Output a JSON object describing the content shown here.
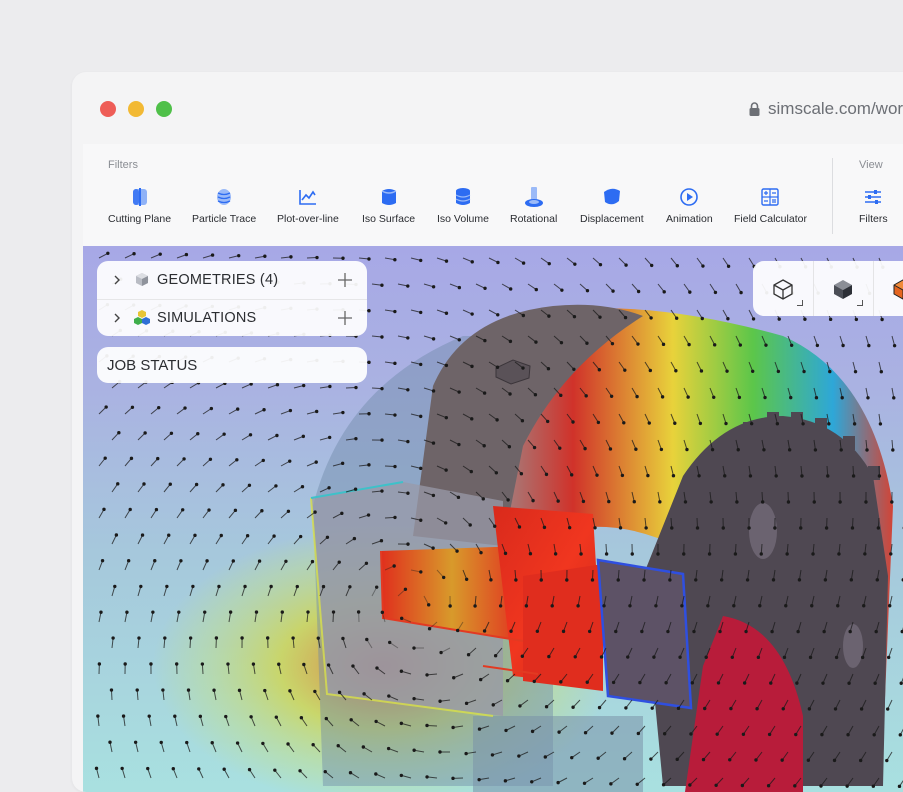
{
  "browser": {
    "url": "simscale.com/work"
  },
  "toolbar": {
    "filters_label": "Filters",
    "view_label": "View",
    "tools": [
      {
        "label": "Cutting Plane",
        "icon": "cutting-plane-icon"
      },
      {
        "label": "Particle Trace",
        "icon": "particle-trace-icon"
      },
      {
        "label": "Plot-over-line",
        "icon": "plot-over-line-icon"
      },
      {
        "label": "Iso Surface",
        "icon": "iso-surface-icon"
      },
      {
        "label": "Iso Volume",
        "icon": "iso-volume-icon"
      },
      {
        "label": "Rotational",
        "icon": "rotational-icon"
      },
      {
        "label": "Displacement",
        "icon": "displacement-icon"
      },
      {
        "label": "Animation",
        "icon": "animation-icon"
      },
      {
        "label": "Field Calculator",
        "icon": "field-calculator-icon"
      }
    ],
    "view_tools": [
      {
        "label": "Filters",
        "icon": "filters-sliders-icon"
      }
    ],
    "accent": "#2d6cf2"
  },
  "tree": {
    "geometries_label": "GEOMETRIES",
    "geometries_count": "(4)",
    "simulations_label": "SIMULATIONS"
  },
  "job_status": {
    "label": "JOB STATUS"
  },
  "view_cube": {
    "buttons": [
      "wireframe-cube-icon",
      "solid-cube-icon",
      "orange-cube-icon"
    ]
  }
}
